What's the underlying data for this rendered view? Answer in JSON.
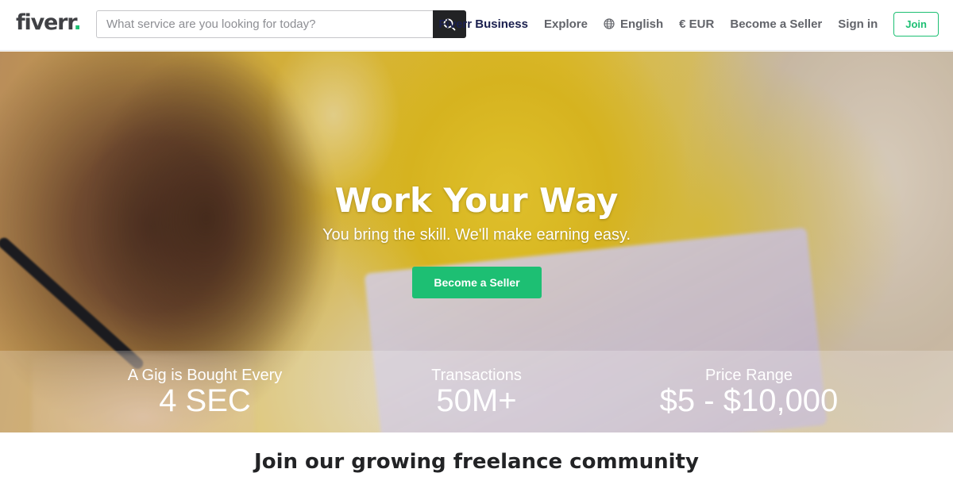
{
  "header": {
    "logo_text": "fiverr",
    "logo_dot": ".",
    "search": {
      "placeholder": "What service are you looking for today?",
      "value": "",
      "button_icon": "search-icon"
    },
    "nav": {
      "business": "Fiverr Business",
      "explore": "Explore",
      "language": "English",
      "language_icon": "globe-icon",
      "currency": "€ EUR",
      "become_seller": "Become a Seller",
      "sign_in": "Sign in",
      "join": "Join"
    }
  },
  "hero": {
    "title": "Work Your Way",
    "subtitle": "You bring the skill. We'll make earning easy.",
    "cta": "Become a Seller"
  },
  "stats": [
    {
      "label": "A Gig is Bought Every",
      "value": "4 SEC"
    },
    {
      "label": "Transactions",
      "value": "50M+"
    },
    {
      "label": "Price Range",
      "value": "$5 - $10,000"
    }
  ],
  "community": {
    "title": "Join our growing freelance community"
  },
  "colors": {
    "brand_green": "#1dbf73",
    "text_dark": "#404145",
    "business_navy": "#1a1f4e"
  }
}
